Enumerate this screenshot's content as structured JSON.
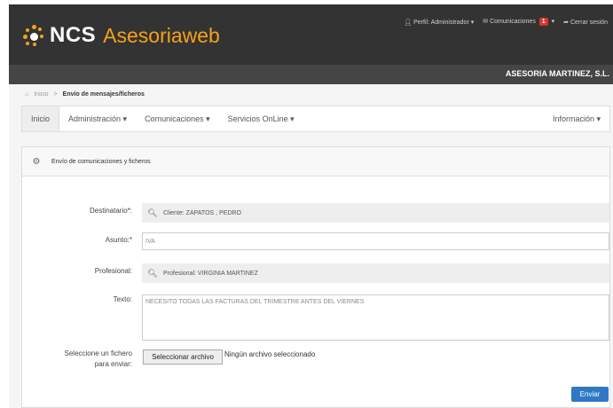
{
  "header": {
    "brand_ncs": "NCS",
    "brand_product": "Asesoriaweb",
    "profile_link": "Perfil: Administrador",
    "messages_link": "Comunicaciones",
    "messages_count": "1",
    "logout_link": "Cerrar sesión",
    "company": "ASESORIA MARTINEZ, S.L."
  },
  "breadcrumb": {
    "home": "Inicio",
    "separator": ">",
    "current": "Envío de mensajes/ficheros"
  },
  "nav": {
    "items": [
      {
        "label": "Inicio"
      },
      {
        "label": "Administración ▾"
      },
      {
        "label": "Comunicaciones ▾"
      },
      {
        "label": "Servicios OnLine ▾"
      }
    ],
    "right_label": "Información ▾"
  },
  "panel": {
    "title": "Envío de comunicaciones y ficheros"
  },
  "form": {
    "recipient_label": "Destinatario*:",
    "recipient_value": "Cliente: ZAPATOS , PEDRO",
    "subject_label": "Asunto:*",
    "subject_value": "IVA",
    "professional_label": "Profesional:",
    "professional_value": "Profesional: VIRGINIA MARTINEZ",
    "text_label": "Texto:",
    "text_value": "NECESITO TODAS LAS FACTURAS DEL TRIMESTRE ANTES DEL VIERNES",
    "file_label_1": "Seleccione un fichero",
    "file_label_2": "para enviar:",
    "file_button": "Seleccionar archivo",
    "file_status": "Ningún archivo seleccionado",
    "send_button": "Enviar"
  },
  "colors": {
    "brand_orange": "#f4a21b",
    "topbar": "#333333",
    "send_blue": "#2f78c4"
  }
}
